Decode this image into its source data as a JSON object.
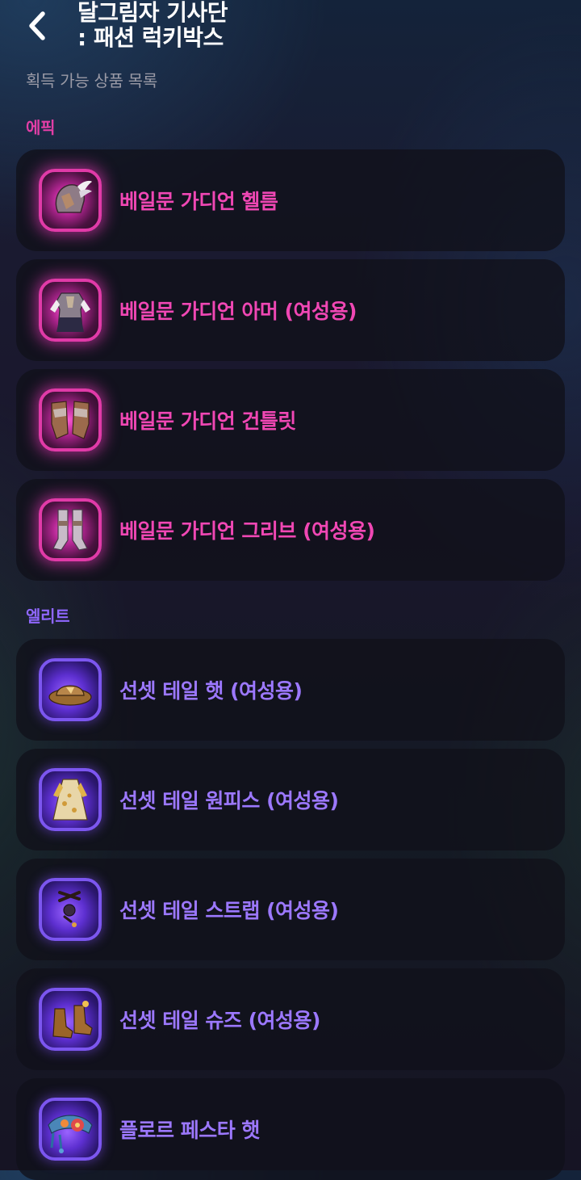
{
  "header": {
    "title_line1": "달그림자 기사단",
    "title_line2": ": 패션 럭키박스",
    "subtitle": "획득 가능 상품 목록"
  },
  "sections": {
    "epic": {
      "label": "에픽",
      "color": "#e23ea6",
      "items": [
        {
          "name": "베일문 가디언 헬름",
          "icon": "helmet-icon"
        },
        {
          "name": "베일문 가디언 아머 (여성용)",
          "icon": "armor-icon"
        },
        {
          "name": "베일문 가디언 건틀릿",
          "icon": "gauntlet-icon"
        },
        {
          "name": "베일문 가디언 그리브 (여성용)",
          "icon": "greaves-icon"
        }
      ]
    },
    "elite": {
      "label": "엘리트",
      "color": "#8f67ff",
      "items": [
        {
          "name": "선셋 테일 햇 (여성용)",
          "icon": "hat-icon"
        },
        {
          "name": "선셋 테일 원피스 (여성용)",
          "icon": "dress-icon"
        },
        {
          "name": "선셋 테일 스트랩 (여성용)",
          "icon": "strap-icon"
        },
        {
          "name": "선셋 테일 슈즈 (여성용)",
          "icon": "shoes-icon"
        },
        {
          "name": "플로르 페스타 햇",
          "icon": "flower-hat-icon"
        }
      ]
    }
  }
}
